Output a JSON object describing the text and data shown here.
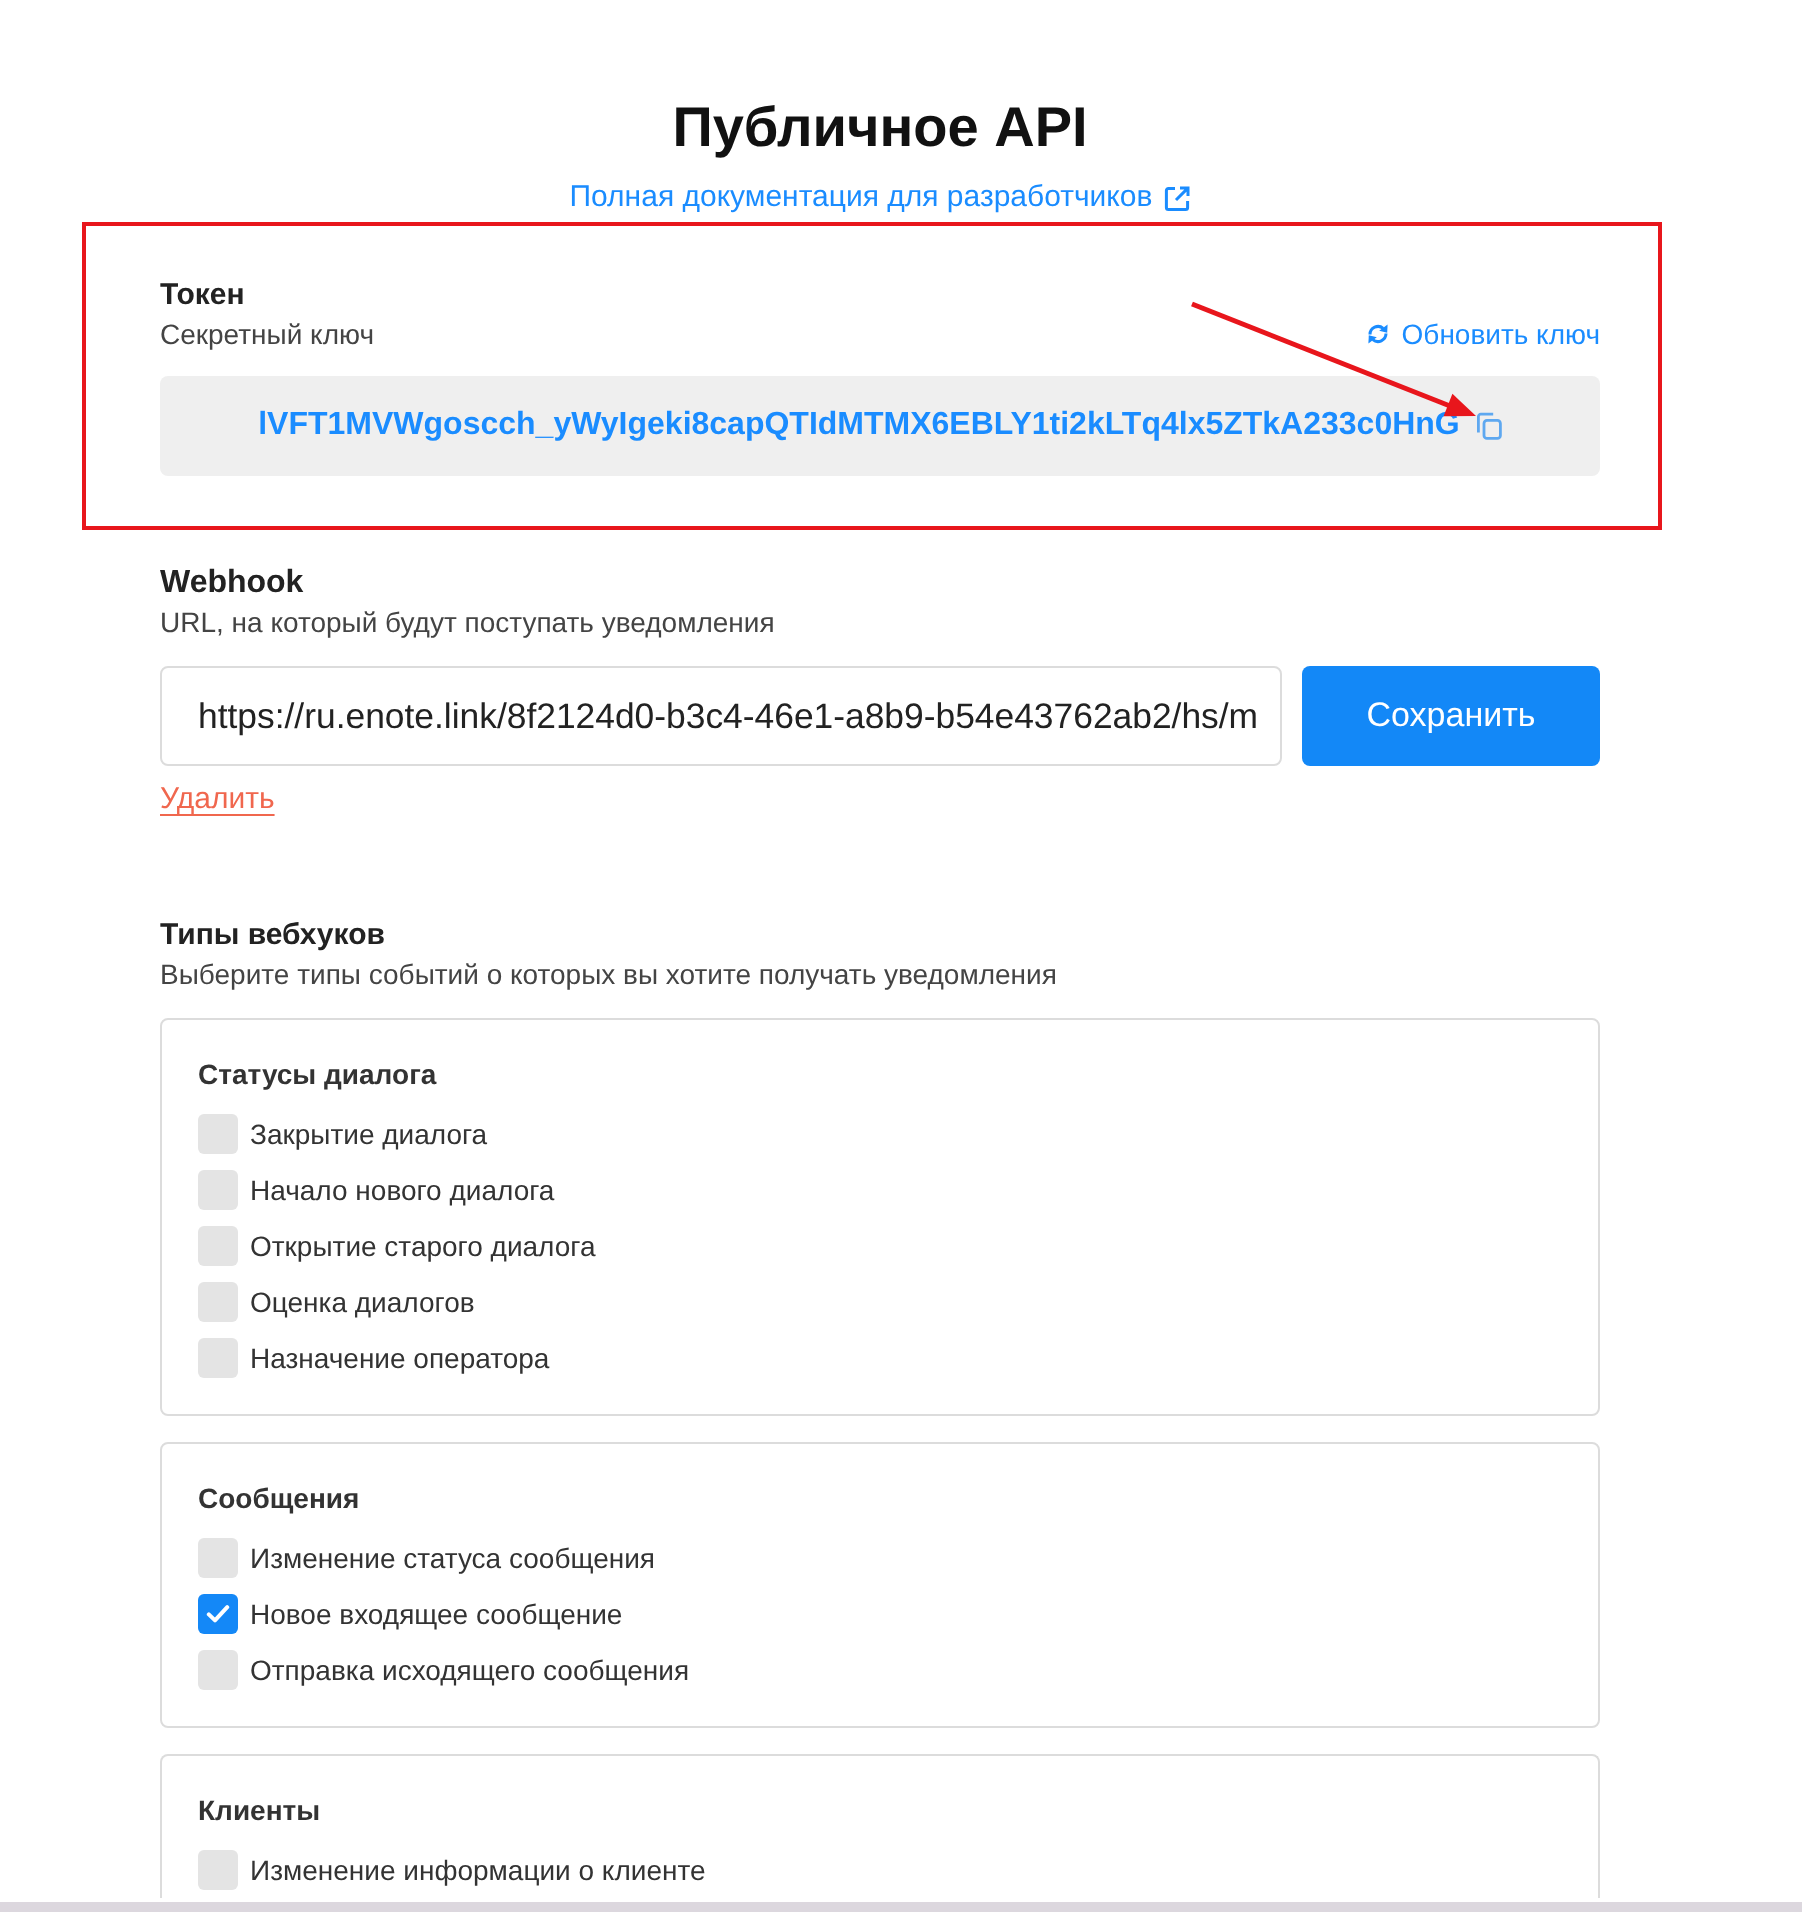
{
  "page": {
    "title": "Публичное API",
    "docs_link": "Полная документация для разработчиков"
  },
  "token": {
    "label": "Токен",
    "description": "Секретный ключ",
    "refresh_link": "Обновить ключ",
    "value": "lVFT1MVWgoscch_yWyIgeki8capQTIdMTMX6EBLY1ti2kLTq4lx5ZTkA233c0HnG"
  },
  "webhook": {
    "label": "Webhook",
    "description": "URL, на который будут поступать уведомления",
    "url": "https://ru.enote.link/8f2124d0-b3c4-46e1-a8b9-b54e43762ab2/hs/m",
    "save_button": "Сохранить",
    "delete_link": "Удалить"
  },
  "webhook_types": {
    "label": "Типы вебхуков",
    "description": "Выберите типы событий о которых вы хотите получать уведомления",
    "groups": [
      {
        "title": "Статусы диалога",
        "options": [
          {
            "label": "Закрытие диалога",
            "checked": false
          },
          {
            "label": "Начало нового диалога",
            "checked": false
          },
          {
            "label": "Открытие старого диалога",
            "checked": false
          },
          {
            "label": "Оценка диалогов",
            "checked": false
          },
          {
            "label": "Назначение оператора",
            "checked": false
          }
        ]
      },
      {
        "title": "Сообщения",
        "options": [
          {
            "label": "Изменение статуса сообщения",
            "checked": false
          },
          {
            "label": "Новое входящее сообщение",
            "checked": true
          },
          {
            "label": "Отправка исходящего сообщения",
            "checked": false
          }
        ]
      },
      {
        "title": "Клиенты",
        "options": [
          {
            "label": "Изменение информации о клиенте",
            "checked": false
          }
        ]
      }
    ]
  },
  "annotations": {
    "highlight_frame": true,
    "arrow": true
  }
}
